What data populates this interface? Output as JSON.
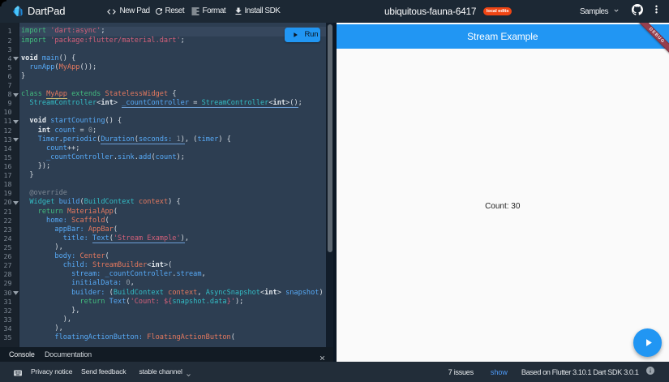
{
  "window": {
    "title": "DartPad"
  },
  "header": {
    "logo": "DartPad",
    "nav": [
      {
        "label": "New Pad",
        "icon": "code"
      },
      {
        "label": "Reset",
        "icon": "refresh"
      },
      {
        "label": "Format",
        "icon": "format-align-left"
      },
      {
        "label": "Install SDK",
        "icon": "download"
      }
    ],
    "pad_name": "ubiquitous-fauna-6417",
    "badge": "local edits",
    "samples": "Samples"
  },
  "editor": {
    "run_label": "Run",
    "fold_lines": [
      4,
      8,
      11,
      13,
      20,
      30
    ],
    "active_line": 1,
    "lines": [
      {
        "n": 1,
        "segs": [
          [
            "import",
            "k"
          ],
          [
            " ",
            "d"
          ],
          [
            "'dart:async'",
            "s"
          ],
          [
            ";",
            "d"
          ]
        ]
      },
      {
        "n": 2,
        "segs": [
          [
            "import",
            "k"
          ],
          [
            " ",
            "d"
          ],
          [
            "'package:flutter/material.dart'",
            "s"
          ],
          [
            ";",
            "d"
          ]
        ]
      },
      {
        "n": 3,
        "segs": []
      },
      {
        "n": 4,
        "segs": [
          [
            "void",
            "b"
          ],
          [
            " ",
            "d"
          ],
          [
            "main",
            "fn"
          ],
          [
            "() {",
            "d"
          ]
        ]
      },
      {
        "n": 5,
        "segs": [
          [
            "  ",
            "d"
          ],
          [
            "runApp",
            "fn"
          ],
          [
            "(",
            "d"
          ],
          [
            "MyApp",
            "cls"
          ],
          [
            "());",
            "d"
          ]
        ]
      },
      {
        "n": 6,
        "segs": [
          [
            "}",
            "d"
          ]
        ]
      },
      {
        "n": 7,
        "segs": []
      },
      {
        "n": 8,
        "segs": [
          [
            "class",
            "k"
          ],
          [
            " ",
            "d"
          ],
          [
            "MyApp",
            "cls",
            "uy"
          ],
          [
            " ",
            "d"
          ],
          [
            "extends",
            "k"
          ],
          [
            " ",
            "d"
          ],
          [
            "StatelessWidget",
            "cls"
          ],
          [
            " {",
            "d"
          ]
        ]
      },
      {
        "n": 9,
        "segs": [
          [
            "  ",
            "d"
          ],
          [
            "StreamController",
            "ty"
          ],
          [
            "<",
            "d"
          ],
          [
            "int",
            "b"
          ],
          [
            "> ",
            "d"
          ],
          [
            "_countController",
            "fn",
            "ub"
          ],
          [
            " = ",
            "d",
            "ub"
          ],
          [
            "StreamController",
            "ty",
            "ub"
          ],
          [
            "<",
            "d",
            "ub"
          ],
          [
            "int",
            "b",
            "ub"
          ],
          [
            ">",
            "d",
            "ub"
          ],
          [
            "()",
            "d",
            "ub"
          ],
          [
            ";",
            "d"
          ]
        ]
      },
      {
        "n": 10,
        "segs": []
      },
      {
        "n": 11,
        "segs": [
          [
            "  ",
            "d"
          ],
          [
            "void",
            "b"
          ],
          [
            " ",
            "d"
          ],
          [
            "startCounting",
            "fn"
          ],
          [
            "() {",
            "d"
          ]
        ]
      },
      {
        "n": 12,
        "segs": [
          [
            "    ",
            "d"
          ],
          [
            "int",
            "b"
          ],
          [
            " ",
            "d"
          ],
          [
            "count",
            "fn"
          ],
          [
            " = ",
            "d"
          ],
          [
            "0",
            "num"
          ],
          [
            ";",
            "d"
          ]
        ]
      },
      {
        "n": 13,
        "segs": [
          [
            "    ",
            "d"
          ],
          [
            "Timer",
            "fn"
          ],
          [
            ".",
            "d"
          ],
          [
            "periodic",
            "fn"
          ],
          [
            "(",
            "d"
          ],
          [
            "Duration",
            "fn",
            "ub"
          ],
          [
            "(",
            "d",
            "ub"
          ],
          [
            "seconds:",
            "fn",
            "ub"
          ],
          [
            " ",
            "d",
            "ub"
          ],
          [
            "1",
            "num",
            "ub"
          ],
          [
            ")",
            "d",
            "ub"
          ],
          [
            ", (",
            "d"
          ],
          [
            "timer",
            "fn"
          ],
          [
            ") {",
            "d"
          ]
        ]
      },
      {
        "n": 14,
        "segs": [
          [
            "      ",
            "d"
          ],
          [
            "count",
            "fn"
          ],
          [
            "++;",
            "d"
          ]
        ]
      },
      {
        "n": 15,
        "segs": [
          [
            "      ",
            "d"
          ],
          [
            "_countController",
            "fn"
          ],
          [
            ".",
            "d"
          ],
          [
            "sink",
            "fn"
          ],
          [
            ".",
            "d"
          ],
          [
            "add",
            "fn"
          ],
          [
            "(",
            "d"
          ],
          [
            "count",
            "fn"
          ],
          [
            ");",
            "d"
          ]
        ]
      },
      {
        "n": 16,
        "segs": [
          [
            "    });",
            "d"
          ]
        ]
      },
      {
        "n": 17,
        "segs": [
          [
            "  }",
            "d"
          ]
        ]
      },
      {
        "n": 18,
        "segs": []
      },
      {
        "n": 19,
        "segs": [
          [
            "  ",
            "d"
          ],
          [
            "@override",
            "cm"
          ]
        ]
      },
      {
        "n": 20,
        "segs": [
          [
            "  ",
            "d"
          ],
          [
            "Widget",
            "ty"
          ],
          [
            " ",
            "d"
          ],
          [
            "build",
            "fn"
          ],
          [
            "(",
            "d"
          ],
          [
            "BuildContext",
            "ty"
          ],
          [
            " ",
            "d"
          ],
          [
            "context",
            "cls"
          ],
          [
            ") {",
            "d"
          ]
        ]
      },
      {
        "n": 21,
        "segs": [
          [
            "    ",
            "d"
          ],
          [
            "return",
            "k"
          ],
          [
            " ",
            "d"
          ],
          [
            "MaterialApp",
            "cls"
          ],
          [
            "(",
            "d"
          ]
        ]
      },
      {
        "n": 22,
        "segs": [
          [
            "      ",
            "d"
          ],
          [
            "home:",
            "fn"
          ],
          [
            " ",
            "d"
          ],
          [
            "Scaffold",
            "cls"
          ],
          [
            "(",
            "d"
          ]
        ]
      },
      {
        "n": 23,
        "segs": [
          [
            "        ",
            "d"
          ],
          [
            "appBar:",
            "fn"
          ],
          [
            " ",
            "d"
          ],
          [
            "AppBar",
            "cls"
          ],
          [
            "(",
            "d"
          ]
        ]
      },
      {
        "n": 24,
        "segs": [
          [
            "          ",
            "d"
          ],
          [
            "title:",
            "fn"
          ],
          [
            " ",
            "d"
          ],
          [
            "Text",
            "fn",
            "ub"
          ],
          [
            "(",
            "d",
            "ub"
          ],
          [
            "'Stream Example'",
            "s",
            "ub"
          ],
          [
            ")",
            "d",
            "ub"
          ],
          [
            ",",
            "d"
          ]
        ]
      },
      {
        "n": 25,
        "segs": [
          [
            "        ),",
            "d"
          ]
        ]
      },
      {
        "n": 26,
        "segs": [
          [
            "        ",
            "d"
          ],
          [
            "body:",
            "fn"
          ],
          [
            " ",
            "d"
          ],
          [
            "Center",
            "cls"
          ],
          [
            "(",
            "d"
          ]
        ]
      },
      {
        "n": 27,
        "segs": [
          [
            "          ",
            "d"
          ],
          [
            "child:",
            "fn"
          ],
          [
            " ",
            "d"
          ],
          [
            "StreamBuilder",
            "cls"
          ],
          [
            "<",
            "d"
          ],
          [
            "int",
            "b"
          ],
          [
            ">",
            "d"
          ],
          [
            "(",
            "d"
          ]
        ]
      },
      {
        "n": 28,
        "segs": [
          [
            "            ",
            "d"
          ],
          [
            "stream:",
            "fn"
          ],
          [
            " ",
            "d"
          ],
          [
            "_countController",
            "fn"
          ],
          [
            ".",
            "d"
          ],
          [
            "stream",
            "fn"
          ],
          [
            ",",
            "d"
          ]
        ]
      },
      {
        "n": 29,
        "segs": [
          [
            "            ",
            "d"
          ],
          [
            "initialData:",
            "fn"
          ],
          [
            " ",
            "d"
          ],
          [
            "0",
            "num"
          ],
          [
            ",",
            "d"
          ]
        ]
      },
      {
        "n": 30,
        "segs": [
          [
            "            ",
            "d"
          ],
          [
            "builder:",
            "fn"
          ],
          [
            " (",
            "d"
          ],
          [
            "BuildContext",
            "ty"
          ],
          [
            " ",
            "d"
          ],
          [
            "context",
            "cls"
          ],
          [
            ", ",
            "d"
          ],
          [
            "AsyncSnapshot",
            "ty"
          ],
          [
            "<",
            "d"
          ],
          [
            "int",
            "b"
          ],
          [
            "> ",
            "d"
          ],
          [
            "snapshot",
            "fn"
          ],
          [
            ") {",
            "d"
          ]
        ]
      },
      {
        "n": 31,
        "segs": [
          [
            "              ",
            "d"
          ],
          [
            "return",
            "k"
          ],
          [
            " ",
            "d"
          ],
          [
            "Text",
            "fn"
          ],
          [
            "(",
            "d"
          ],
          [
            "'Count: ",
            "s"
          ],
          [
            "${",
            "s"
          ],
          [
            "snapshot.data",
            "ty"
          ],
          [
            "}",
            "s"
          ],
          [
            "'",
            "s"
          ],
          [
            ");",
            "d"
          ]
        ]
      },
      {
        "n": 32,
        "segs": [
          [
            "            },",
            "d"
          ]
        ]
      },
      {
        "n": 33,
        "segs": [
          [
            "          ),",
            "d"
          ]
        ]
      },
      {
        "n": 34,
        "segs": [
          [
            "        ),",
            "d"
          ]
        ]
      },
      {
        "n": 35,
        "segs": [
          [
            "        ",
            "d"
          ],
          [
            "floatingActionButton:",
            "fn"
          ],
          [
            " ",
            "d"
          ],
          [
            "FloatingActionButton",
            "cls"
          ],
          [
            "(",
            "d"
          ]
        ]
      }
    ]
  },
  "output": {
    "appbar_title": "Stream Example",
    "debug_banner": "DEBUG",
    "count_text": "Count: 30"
  },
  "console": {
    "tabs": [
      {
        "label": "Console"
      },
      {
        "label": "Documentation"
      }
    ]
  },
  "footer": {
    "privacy": "Privacy notice",
    "feedback": "Send feedback",
    "channel": "stable channel",
    "issues": "7 issues",
    "show": "show",
    "version": "Based on Flutter 3.10.1 Dart SDK 3.0.1"
  },
  "colors": {
    "accent_blue": "#2196f3",
    "badge_red": "#ef4514",
    "debug_banner": "#953f4e",
    "header_bg": "#1c2834",
    "editor_bg": "#2d3e52",
    "footer_bg": "#222d39"
  }
}
